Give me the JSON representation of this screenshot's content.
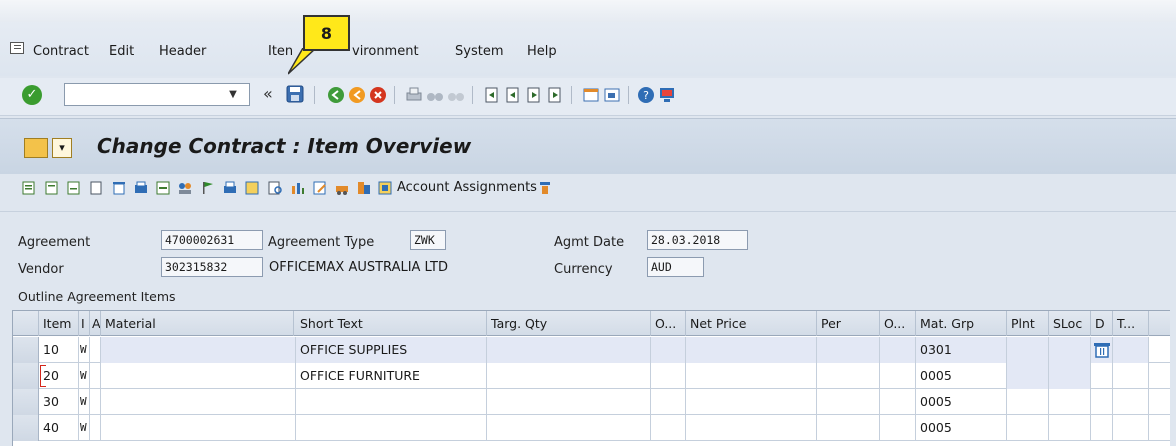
{
  "menu": {
    "items": [
      "Contract",
      "Edit",
      "Header",
      "Item",
      "Environment",
      "System",
      "Help"
    ],
    "item_clipped": "Iten",
    "environment_visible": "vironment"
  },
  "callout": {
    "label": "8"
  },
  "toolbar": {
    "nav_back": "«",
    "dropdown": "▼"
  },
  "title": {
    "text": "Change Contract : Item Overview"
  },
  "app_toolbar": {
    "account_assignments": "Account Assignments"
  },
  "header": {
    "agreement_label": "Agreement",
    "agreement_value": "4700002631",
    "agreement_type_label": "Agreement Type",
    "agreement_type_value": "ZWK",
    "agmt_date_label": "Agmt Date",
    "agmt_date_value": "28.03.2018",
    "vendor_label": "Vendor",
    "vendor_value": "302315832",
    "vendor_name": "OFFICEMAX AUSTRALIA LTD",
    "currency_label": "Currency",
    "currency_value": "AUD"
  },
  "items_section": {
    "label": "Outline Agreement Items"
  },
  "table": {
    "columns": [
      "Item",
      "I",
      "A",
      "Material",
      "Short Text",
      "Targ. Qty",
      "O...",
      "Net Price",
      "Per",
      "O...",
      "Mat. Grp",
      "Plnt",
      "SLoc",
      "D",
      "T..."
    ],
    "rows": [
      {
        "item": "10",
        "i": "W",
        "short_text": "OFFICE SUPPLIES",
        "mat_grp": "0301",
        "deleted_icon": "trash-icon"
      },
      {
        "item": "20",
        "i": "W",
        "short_text": "OFFICE FURNITURE",
        "mat_grp": "0005"
      },
      {
        "item": "30",
        "i": "W",
        "short_text": "",
        "mat_grp": "0005"
      },
      {
        "item": "40",
        "i": "W",
        "short_text": "",
        "mat_grp": "0005"
      }
    ]
  },
  "colors": {
    "callout": "#ffe81a",
    "shaded_row": "#e3e8f5",
    "enter_green": "#3a9c2f"
  }
}
